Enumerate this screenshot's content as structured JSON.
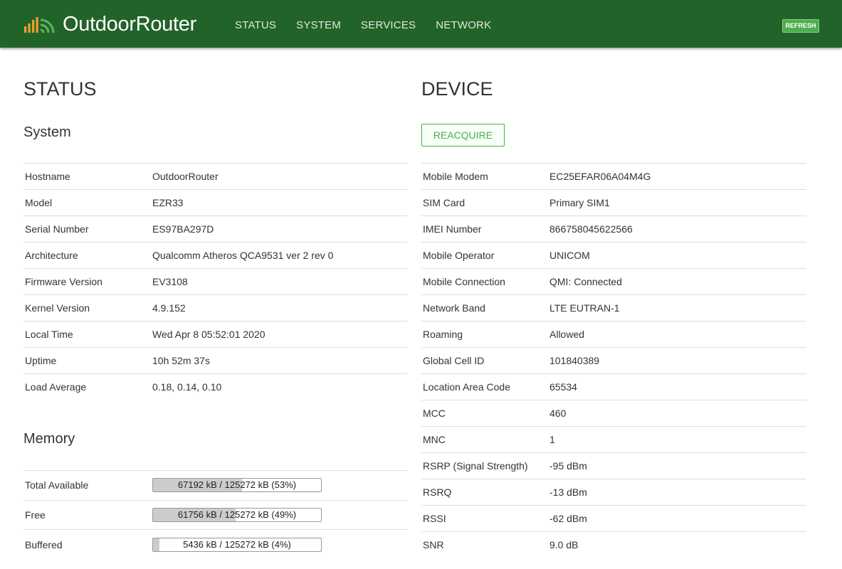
{
  "header": {
    "brand": "OutdoorRouter",
    "nav": [
      "STATUS",
      "SYSTEM",
      "SERVICES",
      "NETWORK"
    ],
    "refresh_label": "REFRESH"
  },
  "left": {
    "title": "STATUS",
    "system": {
      "heading": "System",
      "rows": [
        {
          "label": "Hostname",
          "value": "OutdoorRouter"
        },
        {
          "label": "Model",
          "value": "EZR33"
        },
        {
          "label": "Serial Number",
          "value": "ES97BA297D"
        },
        {
          "label": "Architecture",
          "value": "Qualcomm Atheros QCA9531 ver 2 rev 0"
        },
        {
          "label": "Firmware Version",
          "value": "EV3108"
        },
        {
          "label": "Kernel Version",
          "value": "4.9.152"
        },
        {
          "label": "Local Time",
          "value": "Wed Apr 8 05:52:01 2020"
        },
        {
          "label": "Uptime",
          "value": "10h 52m 37s"
        },
        {
          "label": "Load Average",
          "value": "0.18, 0.14, 0.10"
        }
      ]
    },
    "memory": {
      "heading": "Memory",
      "rows": [
        {
          "label": "Total Available",
          "text": "67192 kB / 125272 kB (53%)",
          "percent": 53
        },
        {
          "label": "Free",
          "text": "61756 kB / 125272 kB (49%)",
          "percent": 49
        },
        {
          "label": "Buffered",
          "text": "5436 kB / 125272 kB (4%)",
          "percent": 4
        }
      ]
    }
  },
  "right": {
    "title": "DEVICE",
    "reacquire_label": "REACQUIRE",
    "rows": [
      {
        "label": "Mobile Modem",
        "value": "EC25EFAR06A04M4G"
      },
      {
        "label": "SIM Card",
        "value": "Primary SIM1"
      },
      {
        "label": "IMEI Number",
        "value": "866758045622566"
      },
      {
        "label": "Mobile Operator",
        "value": "UNICOM"
      },
      {
        "label": "Mobile Connection",
        "value": "QMI: Connected"
      },
      {
        "label": "Network Band",
        "value": "LTE EUTRAN-1"
      },
      {
        "label": "Roaming",
        "value": "Allowed"
      },
      {
        "label": "Global Cell ID",
        "value": "101840389"
      },
      {
        "label": "Location Area Code",
        "value": "65534"
      },
      {
        "label": "MCC",
        "value": "460"
      },
      {
        "label": "MNC",
        "value": "1"
      },
      {
        "label": "RSRP (Signal Strength)",
        "value": "-95 dBm"
      },
      {
        "label": "RSRQ",
        "value": "-13 dBm"
      },
      {
        "label": "RSSI",
        "value": "-62 dBm"
      },
      {
        "label": "SNR",
        "value": "9.0 dB"
      }
    ]
  },
  "colors": {
    "header_bg": "#22632a",
    "accent": "#4cae4c",
    "logo_bars": "#f0a030",
    "logo_waves": "#5cb85c"
  },
  "icons": {
    "logo": "signal-bars-wifi-icon"
  }
}
